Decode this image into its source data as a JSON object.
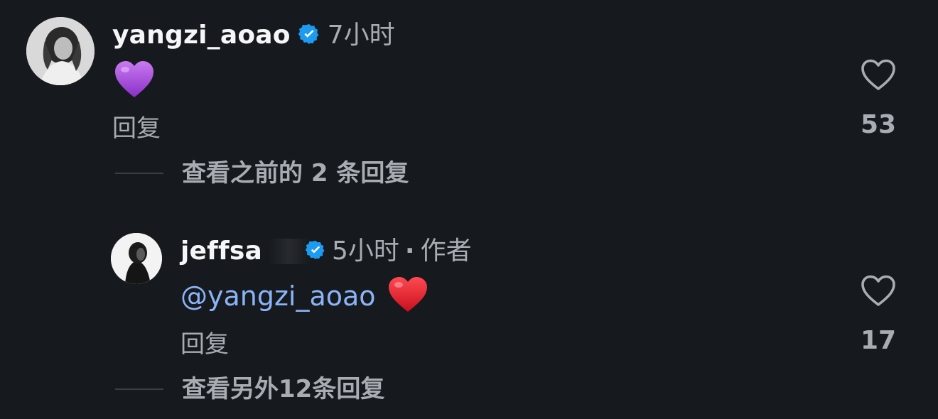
{
  "comments": [
    {
      "username": "yangzi_aoao",
      "time": "7小时",
      "body_emoji": "💜",
      "reply_label": "回复",
      "like_count": "53",
      "view_previous": "查看之前的 2 条回复"
    }
  ],
  "replies": [
    {
      "username": "jeffsa",
      "time": "5小时",
      "separator": "·",
      "author_tag": "作者",
      "mention": "@yangzi_aoao",
      "body_emoji": "❤️",
      "reply_label": "回复",
      "like_count": "17",
      "view_more": "查看另外12条回复"
    }
  ],
  "colors": {
    "background": "#16191d",
    "verified_badge": "#1d9bf0",
    "mention": "#8ab4f8",
    "muted_text": "#a8adb3",
    "heart_purple": "#a54bdc",
    "heart_red": "#e0202e"
  },
  "icons": {
    "verified": "verified-badge-icon",
    "like": "heart-outline-icon"
  }
}
